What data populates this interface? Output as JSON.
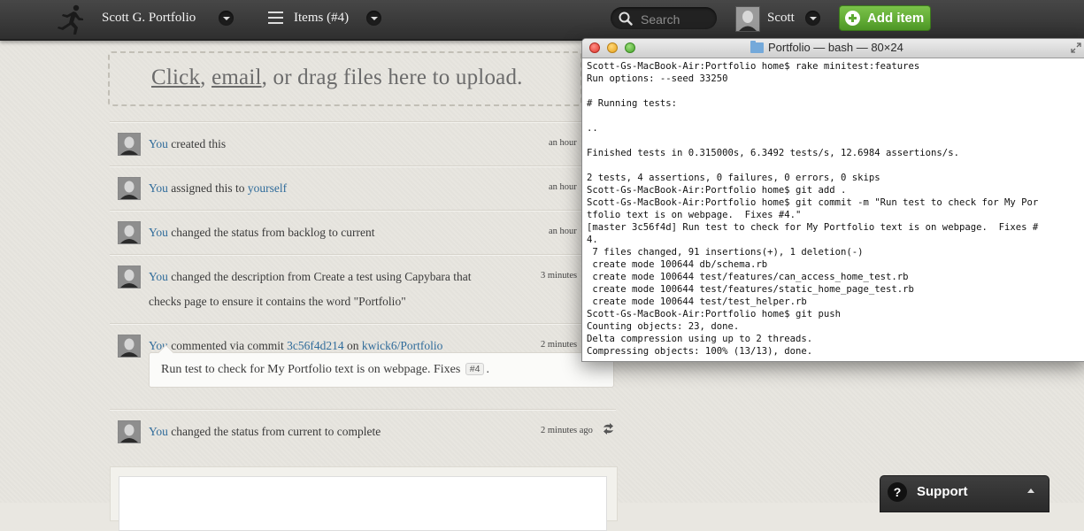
{
  "topbar": {
    "portfolio_label": "Scott G. Portfolio",
    "items_label": "Items (#4)",
    "search_placeholder": "Search",
    "user_name": "Scott",
    "add_item_label": "Add item"
  },
  "upload": {
    "click": "Click",
    "sep1": ", ",
    "email": "email",
    "rest": ", or drag files here to upload."
  },
  "activity": [
    {
      "actor": "You",
      "text": " created this",
      "time": "an hour"
    },
    {
      "actor": "You",
      "text": " assigned this to ",
      "link": "yourself",
      "time": "an hour"
    },
    {
      "actor": "You",
      "text": " changed the status from backlog to current",
      "time": "an hour"
    },
    {
      "actor": "You",
      "text": " changed the description from Create a test using Capybara that",
      "text2": "checks page to ensure it contains the word \"Portfolio\"",
      "time": "3 minutes"
    },
    {
      "actor": "You",
      "text": " commented via commit ",
      "commit": "3c56f4d214",
      "on": " on ",
      "repo": "kwick6/Portfolio",
      "time": "2 minutes",
      "comment": "Run test to check for My Portfolio text is on webpage. Fixes",
      "badge": "#4",
      "end": "."
    },
    {
      "actor": "You",
      "text": " changed the status from current to complete",
      "time": "2 minutes ago"
    }
  ],
  "support": {
    "icon": "?",
    "label": "Support"
  },
  "terminal": {
    "title": "Portfolio — bash — 80×24",
    "lines": [
      "Scott-Gs-MacBook-Air:Portfolio home$ rake minitest:features",
      "Run options: --seed 33250",
      "",
      "# Running tests:",
      "",
      "..",
      "",
      "Finished tests in 0.315000s, 6.3492 tests/s, 12.6984 assertions/s.",
      "",
      "2 tests, 4 assertions, 0 failures, 0 errors, 0 skips",
      "Scott-Gs-MacBook-Air:Portfolio home$ git add .",
      "Scott-Gs-MacBook-Air:Portfolio home$ git commit -m \"Run test to check for My Por",
      "tfolio text is on webpage.  Fixes #4.\"",
      "[master 3c56f4d] Run test to check for My Portfolio text is on webpage.  Fixes #",
      "4.",
      " 7 files changed, 91 insertions(+), 1 deletion(-)",
      " create mode 100644 db/schema.rb",
      " create mode 100644 test/features/can_access_home_test.rb",
      " create mode 100644 test/features/static_home_page_test.rb",
      " create mode 100644 test/test_helper.rb",
      "Scott-Gs-MacBook-Air:Portfolio home$ git push",
      "Counting objects: 23, done.",
      "Delta compression using up to 2 threads.",
      "Compressing objects: 100% (13/13), done."
    ]
  },
  "colors": {
    "link": "#2f6b9a",
    "add_button": "#5ca931",
    "topbar": "#3a3a3a"
  },
  "icons": [
    "runner-logo-icon",
    "list-icon",
    "search-icon",
    "avatar",
    "plus-circle-icon",
    "sync-icon",
    "help-icon",
    "folder-icon",
    "fullscreen-icon"
  ]
}
